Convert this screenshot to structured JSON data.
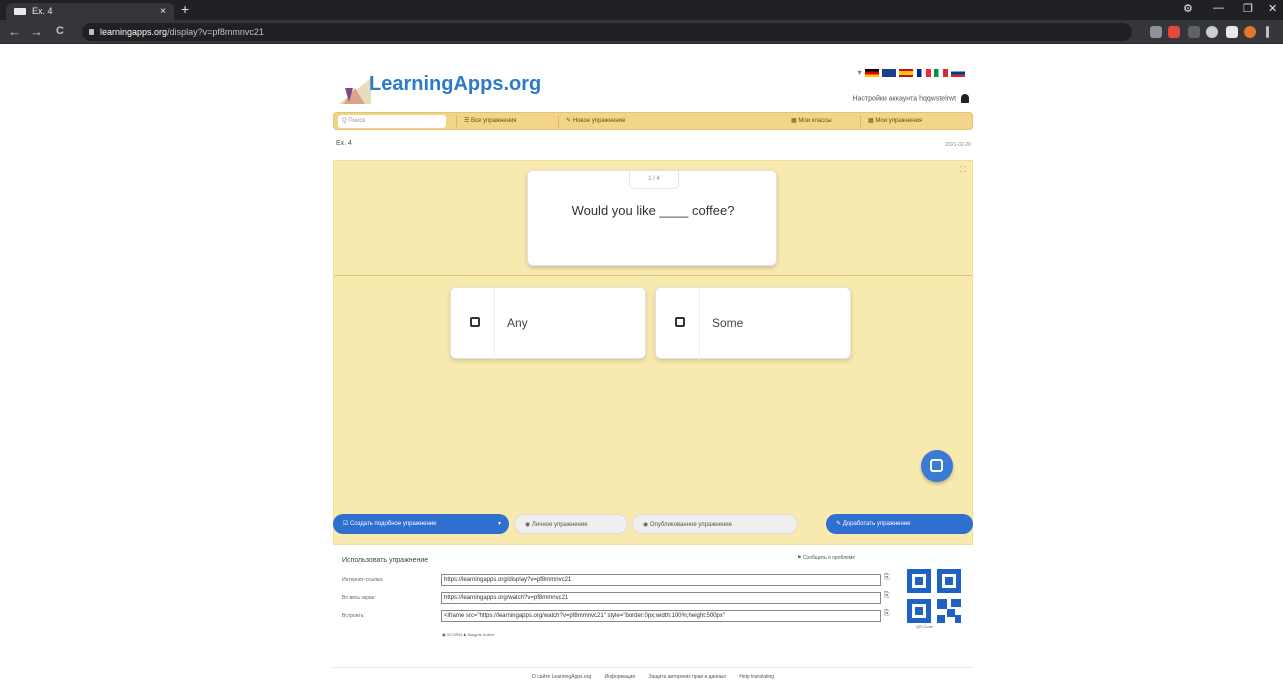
{
  "browser": {
    "tab_title": "Ex. 4",
    "tab_close": "×",
    "new_tab": "+",
    "window_controls": [
      "⚙",
      "—",
      "❐",
      "✕"
    ],
    "nav": [
      "←",
      "→",
      "C"
    ],
    "url_domain": "learningapps.org",
    "url_path": "/display?v=pf8mmnvc21"
  },
  "site": {
    "logo": "LearningApps.org",
    "lang_arrow": "▾",
    "account": "Настройки аккаунта  hqqwstelrwt",
    "menu": {
      "search_placeholder": "Q Поиск",
      "all_exercises": "☰ Все упражнения",
      "new_exercise": "✎ Новое упражнение",
      "my_classes": "▦ Мои классы",
      "my_exercises": "▦ Мои упражнения"
    },
    "page_title": "Ex. 4",
    "date": "2021-02-20"
  },
  "exercise": {
    "counter": "1 / 4",
    "question": "Would you like ____ coffee?",
    "options": [
      {
        "text": "Any",
        "checked": false
      },
      {
        "text": "Some",
        "checked": false
      }
    ]
  },
  "actions": {
    "create_similar": "☑ Создать подобное упражнение",
    "create_similar_menu": "▾",
    "private": "◉ Личное упражнение",
    "public": "◉ Опубликованное упражнение",
    "improve": "✎ Доработать упражнение"
  },
  "use": {
    "title": "Использовать упражнение",
    "report": "⚑ Сообщить о проблеме",
    "rows": [
      {
        "label": "Интернет-ссылка:",
        "value": "https://learningapps.org/display?v=pf8mmnvc21"
      },
      {
        "label": "Во весь экран:",
        "value": "https://learningapps.org/watch?v=pf8mmnvc21"
      },
      {
        "label": "Встроить:",
        "value": "<iframe src=\"https://learningapps.org/watch?v=pf8mmnvc21\" style=\"border:0px;width:100%;height:500px\""
      }
    ],
    "copy_icon": "⎘",
    "qr_label": "QR-Code",
    "meta": "▣ SCORM   ♟ Модуль Author"
  },
  "footer": {
    "links": [
      "О сайте LearningApps.org",
      "Информация",
      "Защита авторских прав и данных",
      "Help translating"
    ]
  },
  "colors": {
    "browser_dark": "#202124",
    "brand_blue": "#2d7ac6",
    "menu_gold": "#f2d58a",
    "app_bg": "#f8e9ae",
    "button_blue": "#2f6fd0"
  }
}
